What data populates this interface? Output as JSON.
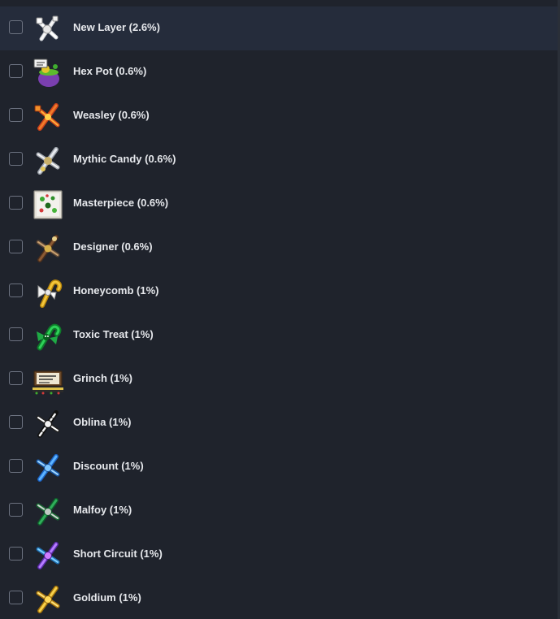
{
  "items": [
    {
      "label": "New Layer (2.6%)",
      "icon": "white-wand-icon",
      "highlighted": true,
      "checked": false
    },
    {
      "label": "Hex Pot (0.6%)",
      "icon": "cauldron-icon",
      "highlighted": false,
      "checked": false
    },
    {
      "label": "Weasley (0.6%)",
      "icon": "orange-wand-icon",
      "highlighted": false,
      "checked": false
    },
    {
      "label": "Mythic Candy (0.6%)",
      "icon": "silver-candy-wand-icon",
      "highlighted": false,
      "checked": false
    },
    {
      "label": "Masterpiece (0.6%)",
      "icon": "painted-canvas-icon",
      "highlighted": false,
      "checked": false
    },
    {
      "label": "Designer (0.6%)",
      "icon": "brown-wand-icon",
      "highlighted": false,
      "checked": false
    },
    {
      "label": "Honeycomb (1%)",
      "icon": "honeycomb-candy-cane-icon",
      "highlighted": false,
      "checked": false
    },
    {
      "label": "Toxic Treat (1%)",
      "icon": "green-candy-icon",
      "highlighted": false,
      "checked": false
    },
    {
      "label": "Grinch (1%)",
      "icon": "grinch-sign-icon",
      "highlighted": false,
      "checked": false
    },
    {
      "label": "Oblina (1%)",
      "icon": "black-white-wand-icon",
      "highlighted": false,
      "checked": false
    },
    {
      "label": "Discount (1%)",
      "icon": "blue-wand-icon",
      "highlighted": false,
      "checked": false
    },
    {
      "label": "Malfoy (1%)",
      "icon": "green-wand-icon",
      "highlighted": false,
      "checked": false
    },
    {
      "label": "Short Circuit (1%)",
      "icon": "purple-wand-icon",
      "highlighted": false,
      "checked": false
    },
    {
      "label": "Goldium (1%)",
      "icon": "gold-wand-icon",
      "highlighted": false,
      "checked": false
    }
  ],
  "colors": {
    "background": "#1f232c",
    "highlight": "#252c3b",
    "text": "#e6e8ec",
    "checkbox_border": "#6c7280"
  }
}
